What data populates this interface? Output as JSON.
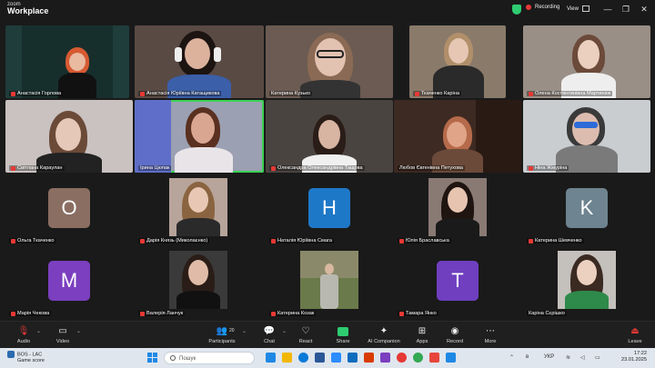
{
  "app": {
    "logo_line1": "zoom",
    "logo_line2": "Workplace",
    "recording_label": "Recording",
    "view_label": "View"
  },
  "participants": [
    {
      "name": "Анастасія Горлова"
    },
    {
      "name": "Анастасія Юріївна Катащикова"
    },
    {
      "name": "Катерина Кузько"
    },
    {
      "name": "Ткаченко Каріна"
    },
    {
      "name": "Олена Костянтинівна Мартинюк"
    },
    {
      "name": "Світлана Караулан"
    },
    {
      "name": "Ірина Цюпак"
    },
    {
      "name": "Олександра Олександрівна Тащова"
    },
    {
      "name": "Любов Євгенівна Петухова"
    },
    {
      "name": "Ніна Жмуріна"
    },
    {
      "name": "Ольга Ткаченко",
      "initial": "O",
      "color": "#8a6e62"
    },
    {
      "name": "Дарія Князь (Миколаєнко)"
    },
    {
      "name": "Наталія Юріївна Смага",
      "initial": "H",
      "color": "#1e78c8"
    },
    {
      "name": "Юлія Браславська"
    },
    {
      "name": "Катерина Шевченко",
      "initial": "K",
      "color": "#6e8490"
    },
    {
      "name": "Марія Чекова",
      "initial": "M",
      "color": "#7b3fbf"
    },
    {
      "name": "Валерія Ланчук"
    },
    {
      "name": "Катерина Козак"
    },
    {
      "name": "Тамара Янко",
      "initial": "T",
      "color": "#6f3fbf"
    },
    {
      "name": "Каріна Сєрішко"
    }
  ],
  "toolbar": {
    "audio": "Audio",
    "video": "Video",
    "participants": "Participants",
    "participants_count": "20",
    "chat": "Chat",
    "react": "React",
    "share": "Share",
    "ai_companion": "AI Companion",
    "apps": "Apps",
    "record": "Record",
    "more": "More",
    "leave": "Leave"
  },
  "taskbar": {
    "weather_title": "BOS - LAC",
    "weather_sub": "Game score",
    "search_placeholder": "Пошук",
    "language": "УКР",
    "time": "17:22",
    "date": "23.01.2025"
  },
  "colors": {
    "active_speaker": "#39d353",
    "recording_dot": "#e53935",
    "share_green": "#2ecc71"
  }
}
